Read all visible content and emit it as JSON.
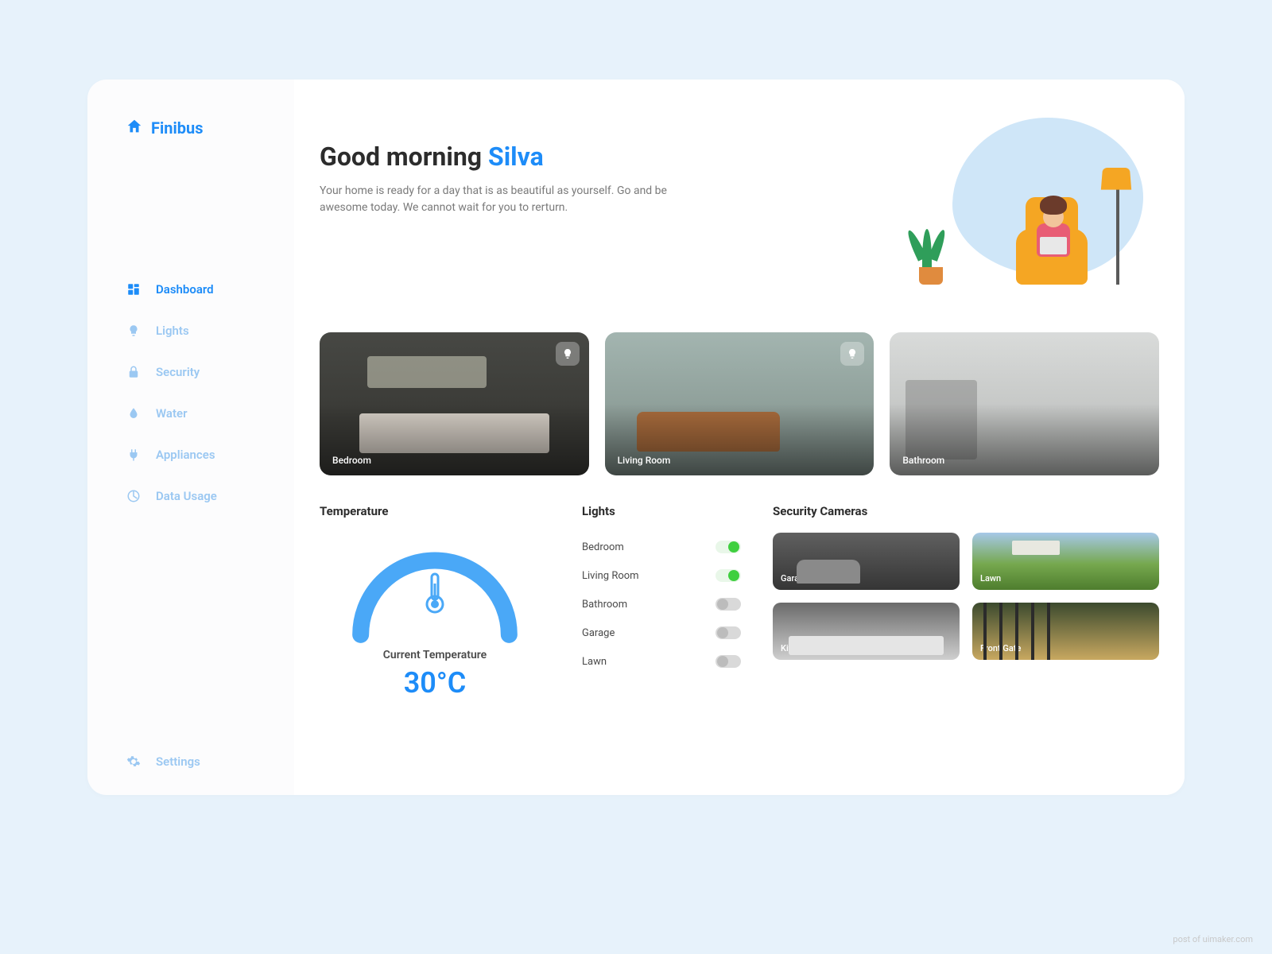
{
  "brand": {
    "name": "Finibus"
  },
  "sidebar": {
    "items": [
      {
        "label": "Dashboard",
        "icon": "dashboard-icon",
        "active": true
      },
      {
        "label": "Lights",
        "icon": "bulb-icon",
        "active": false
      },
      {
        "label": "Security",
        "icon": "lock-icon",
        "active": false
      },
      {
        "label": "Water",
        "icon": "water-icon",
        "active": false
      },
      {
        "label": "Appliances",
        "icon": "plug-icon",
        "active": false
      },
      {
        "label": "Data Usage",
        "icon": "data-icon",
        "active": false
      }
    ],
    "settings_label": "Settings"
  },
  "hero": {
    "greeting_prefix": "Good morning ",
    "user_name": "Silva",
    "subtitle": "Your home is ready for a day that is as beautiful as yourself. Go and be awesome today. We cannot wait for you to rerturn."
  },
  "rooms": [
    {
      "label": "Bedroom",
      "css": "bedroom-bg",
      "has_bulb": true
    },
    {
      "label": "Living Room",
      "css": "living-bg",
      "has_bulb": true
    },
    {
      "label": "Bathroom",
      "css": "bath-bg",
      "has_bulb": false
    }
  ],
  "temperature": {
    "title": "Temperature",
    "label": "Current Temperature",
    "value": "30°C"
  },
  "lights": {
    "title": "Lights",
    "items": [
      {
        "name": "Bedroom",
        "on": true
      },
      {
        "name": "Living Room",
        "on": true
      },
      {
        "name": "Bathroom",
        "on": false
      },
      {
        "name": "Garage",
        "on": false
      },
      {
        "name": "Lawn",
        "on": false
      }
    ]
  },
  "cameras": {
    "title": "Security Cameras",
    "items": [
      {
        "name": "Garage",
        "css": "cam-garage"
      },
      {
        "name": "Lawn",
        "css": "cam-lawn"
      },
      {
        "name": "Kitchen",
        "css": "cam-kitchen"
      },
      {
        "name": "Front Gate",
        "css": "cam-gate"
      }
    ]
  },
  "watermark": "post of uimaker.com"
}
